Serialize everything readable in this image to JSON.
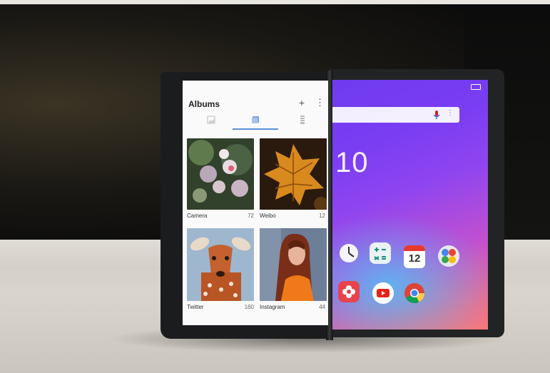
{
  "albums_app": {
    "title": "Albums",
    "add_symbol": "+",
    "more_symbol": "⋮",
    "tabs": [
      "photos",
      "albums",
      "collections"
    ],
    "albums": [
      {
        "name": "Camera",
        "count": "72"
      },
      {
        "name": "Weibo",
        "count": "12"
      },
      {
        "name": "Twitter",
        "count": "160"
      },
      {
        "name": "Instagram",
        "count": "44"
      }
    ]
  },
  "home_screen": {
    "clock": "10",
    "search_more_symbol": "⋮",
    "calendar_day": "12",
    "app_icons": [
      "clock-icon",
      "calculator-icon",
      "calendar-icon",
      "google-apps-icon",
      "flower-app-icon",
      "youtube-icon",
      "chrome-icon"
    ]
  },
  "colors": {
    "wallpaper_top": "#6f3bf0",
    "wallpaper_bottom": "#f57a7a",
    "tab_accent": "#5a8fd8"
  }
}
